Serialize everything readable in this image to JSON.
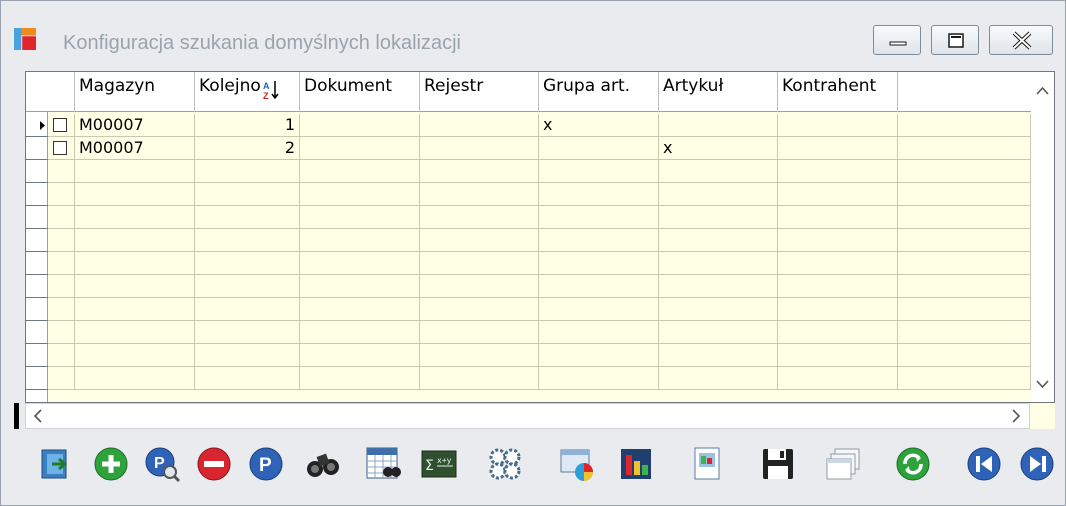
{
  "window": {
    "title": "Konfiguracja szukania domyślnych lokalizacji",
    "accent": "#9aa4ad",
    "grid_bg": "#ffffe6"
  },
  "grid": {
    "columns": [
      "Magazyn",
      "Kolejno",
      "Dokument",
      "Rejestr",
      "Grupa art.",
      "Artykuł",
      "Kontrahent",
      ""
    ],
    "rows": [
      {
        "magazyn": "M00007",
        "kolejnosc": "1",
        "dokument": "",
        "rejestr": "",
        "grupa_art": "x",
        "artykul": "",
        "kontrahent": ""
      },
      {
        "magazyn": "M00007",
        "kolejnosc": "2",
        "dokument": "",
        "rejestr": "",
        "grupa_art": "",
        "artykul": "x",
        "kontrahent": ""
      }
    ],
    "sort_icon": "sort-az-desc-icon"
  },
  "toolbar": {
    "icons": [
      "exit-icon",
      "add-icon",
      "preview-icon",
      "delete-icon",
      "p-icon",
      "binoculars-icon",
      "filter-grid-icon",
      "sum-icon",
      "settings-icon",
      "chart-window-icon",
      "bar-chart-icon",
      "document-icon",
      "save-icon",
      "windows-icon",
      "refresh-icon",
      "first-record-icon",
      "next-record-icon"
    ]
  }
}
